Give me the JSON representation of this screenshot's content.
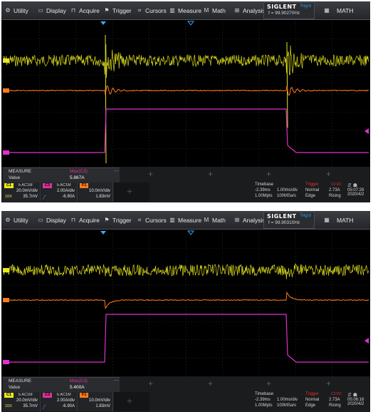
{
  "menu": {
    "utility": "Utility",
    "display": "Display",
    "acquire": "Acquire",
    "trigger": "Trigger",
    "cursors": "Cursors",
    "measure": "Measure",
    "math": "Math",
    "analysis": "Analysis",
    "brand": "SIGLENT",
    "trig_state": "Trig'd",
    "math_right": "MATH"
  },
  "screens": [
    {
      "frequency": "f = 99.90270Hz",
      "measure": {
        "title": "MEASURE",
        "source": "Max(C3)",
        "label": "Value",
        "value": "5.867A"
      },
      "clock_time": "05:07:26",
      "clock_date": "2020/4/2",
      "ringing": "strong"
    },
    {
      "frequency": "f = 99.90310Hz",
      "measure": {
        "title": "MEASURE",
        "source": "Max(C3)",
        "label": "Value",
        "value": "5.400A"
      },
      "clock_time": "05:06:16",
      "clock_date": "2020/4/2",
      "ringing": "weak"
    }
  ],
  "channels": {
    "c1": {
      "tag": "C1",
      "coupling": "b AC1M",
      "scale": "20.0mV/div",
      "offset": "35.7mV",
      "probe": "10X",
      "color": "#e8e820"
    },
    "c3": {
      "tag": "C3",
      "coupling": "b AC1M",
      "scale": "2.00A/div",
      "offset": "-6.90A",
      "color": "#e0309a"
    },
    "f1": {
      "tag": "F1",
      "scale": "10.0mV/div",
      "offset": "1.83mV",
      "color": "#ff7a1a"
    }
  },
  "timebase": {
    "title": "Timebase",
    "delay": "-2.39ms",
    "scale": "1.00ms/div",
    "points": "1.00Mpts",
    "rate": "100MSa/s"
  },
  "trigger": {
    "title": "Trigger",
    "mode": "Normal",
    "type": "Edge",
    "level": "2.73A",
    "slope": "Rising",
    "channel": "C3 DC"
  },
  "icons": {
    "utility": "wrench-icon",
    "display": "monitor-icon",
    "acquire": "acquire-icon",
    "trigger": "flag-icon",
    "cursors": "cursor-icon",
    "measure": "bar-chart-icon",
    "math": "math-icon",
    "analysis": "analysis-icon",
    "math_right": "grid-icon"
  },
  "colors": {
    "c1": "#e8e820",
    "c3": "#e0309a",
    "f1": "#ff7a1a",
    "trigger": "#e03030",
    "accent": "#39a6ff"
  }
}
